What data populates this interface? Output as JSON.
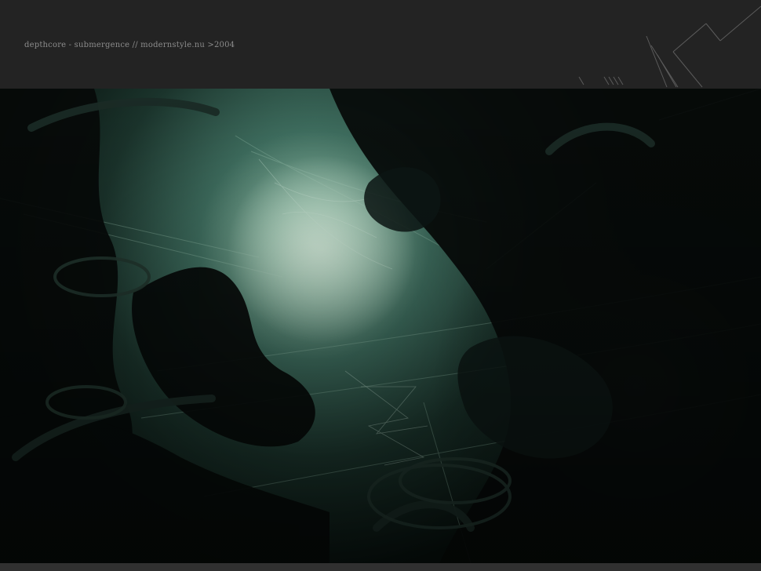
{
  "header": {
    "caption": "depthcore - submergence // modernstyle.nu >2004"
  },
  "artwork": {
    "subject": "dark abstract underwater scene",
    "colors": {
      "glow": "#b9dcc6",
      "teal": "#3b6a5c",
      "deep": "#0b1512",
      "silhouette": "#060a09"
    }
  }
}
